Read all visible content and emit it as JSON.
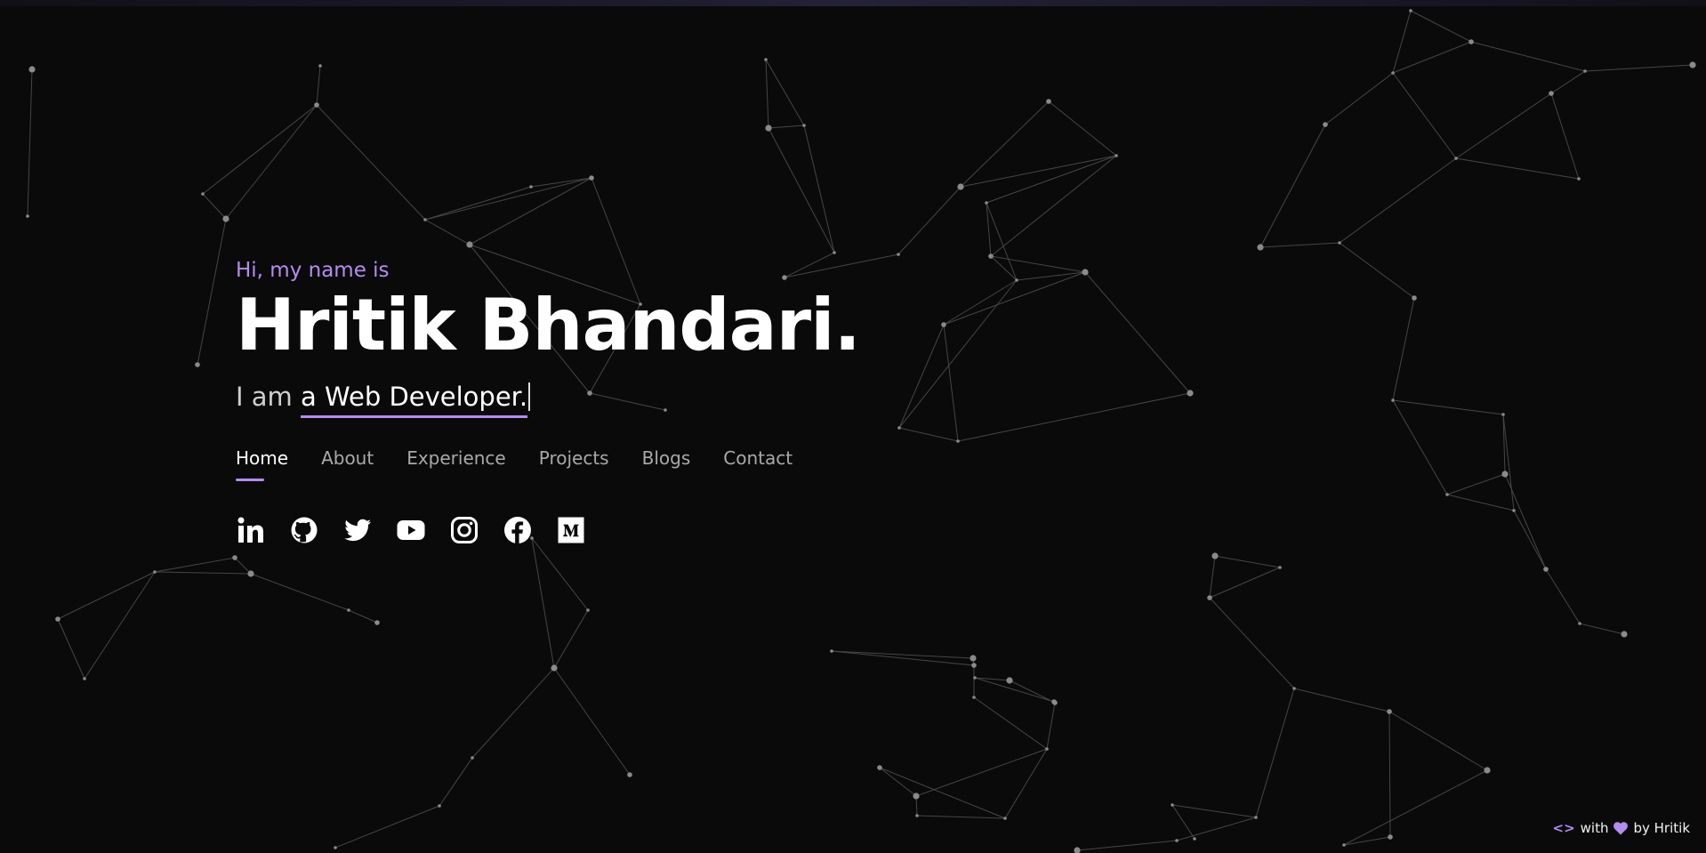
{
  "hero": {
    "greeting": "Hi, my name is",
    "name": "Hritik Bhandari.",
    "tagline_lead": "I am",
    "tagline_role": "a Web Developer."
  },
  "nav": {
    "items": [
      {
        "label": "Home",
        "active": true
      },
      {
        "label": "About",
        "active": false
      },
      {
        "label": "Experience",
        "active": false
      },
      {
        "label": "Projects",
        "active": false
      },
      {
        "label": "Blogs",
        "active": false
      },
      {
        "label": "Contact",
        "active": false
      }
    ]
  },
  "socials": [
    {
      "icon": "linkedin-icon"
    },
    {
      "icon": "github-icon"
    },
    {
      "icon": "twitter-icon"
    },
    {
      "icon": "youtube-icon"
    },
    {
      "icon": "instagram-icon"
    },
    {
      "icon": "facebook-icon"
    },
    {
      "icon": "medium-icon"
    }
  ],
  "footer": {
    "code_symbol": "<>",
    "with_text": "with",
    "by_text": "by Hritik"
  },
  "colors": {
    "background": "#0a0a0b",
    "accent": "#b58cf0",
    "text_primary": "#ffffff",
    "text_muted": "#a9a9a9",
    "network_line": "#5a5a5a",
    "network_node": "#8a8a8a"
  }
}
